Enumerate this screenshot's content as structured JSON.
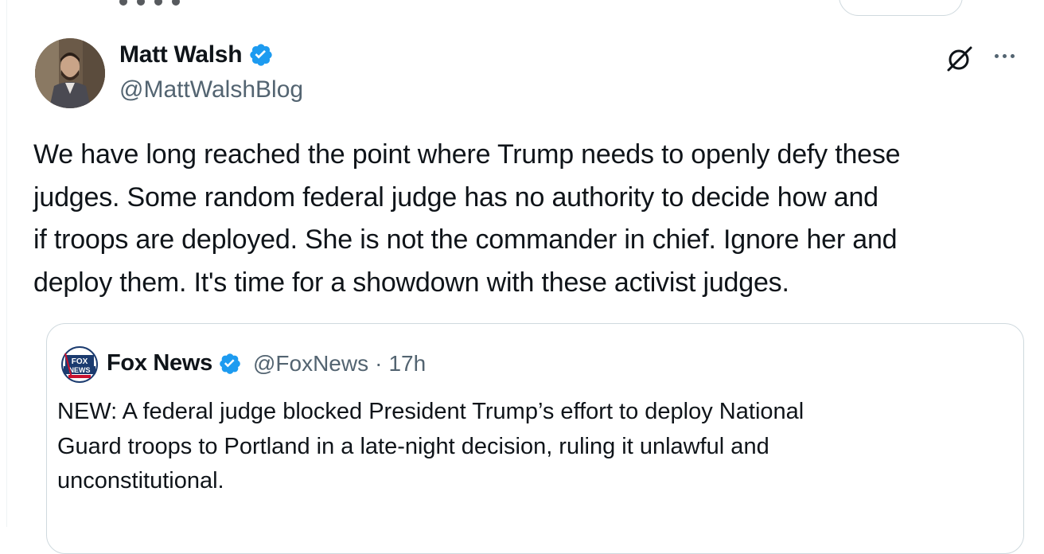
{
  "tweet": {
    "author": {
      "name": "Matt Walsh",
      "handle": "@MattWalshBlog",
      "verified": true
    },
    "text_lines": [
      "We have long reached the point where Trump needs to openly defy these",
      "judges. Some random federal judge has no authority to decide how and",
      "if troops are deployed. She is not the commander in chief. Ignore her and",
      "deploy them. It's time for a showdown with these activist judges."
    ],
    "icons": {
      "grok": "grok-icon",
      "more": "more-options-icon",
      "verified": "verified-badge-icon"
    }
  },
  "quoted_tweet": {
    "author": {
      "name": "Fox News",
      "handle": "@FoxNews",
      "separator": "·",
      "time": "17h",
      "logo": "fox-news-channel-logo"
    },
    "text_lines": [
      "NEW: A federal judge blocked President Trump’s effort to deploy National",
      "Guard troops to Portland in a late-night decision, ruling it unlawful and",
      "unconstitutional."
    ]
  },
  "colors": {
    "text": "#0f1419",
    "secondary": "#536471",
    "verified_blue": "#1d9bf0",
    "border": "#cfd9de"
  }
}
